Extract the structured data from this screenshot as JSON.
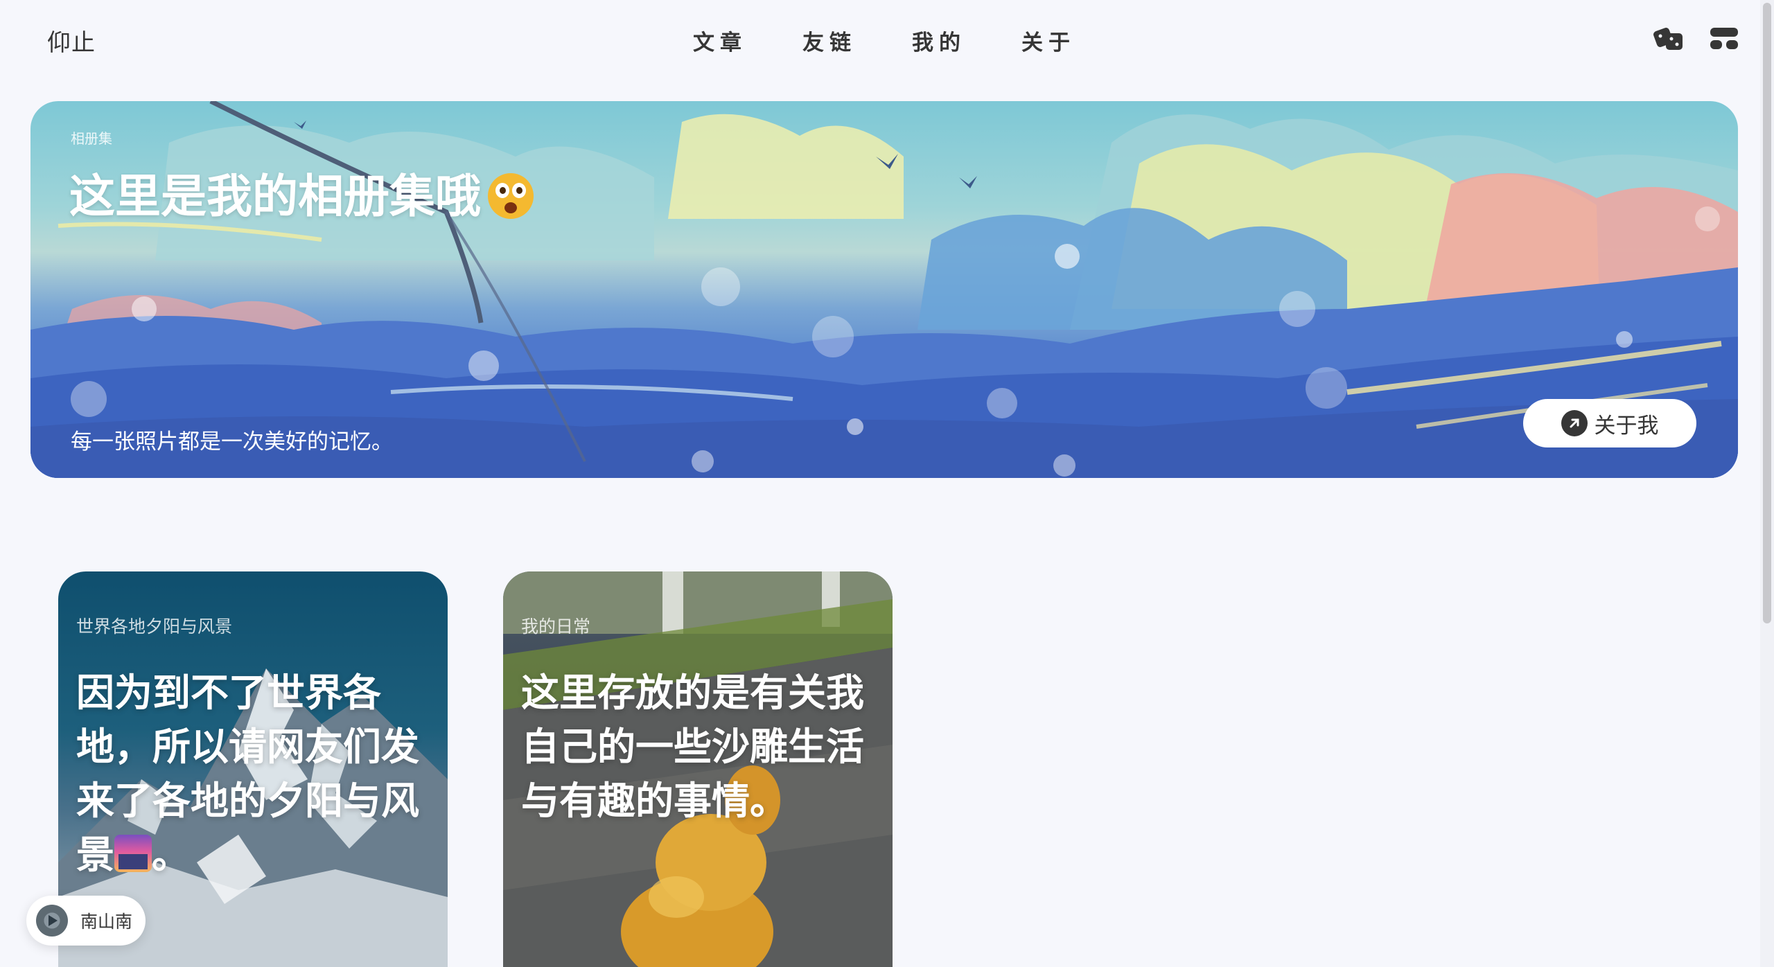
{
  "site": {
    "title": "仰止"
  },
  "nav": {
    "menu": [
      {
        "label": "文章"
      },
      {
        "label": "友链"
      },
      {
        "label": "我的"
      },
      {
        "label": "关于"
      }
    ],
    "icons": [
      "dice-icon",
      "menu-grid-icon"
    ]
  },
  "banner": {
    "kicker": "相册集",
    "title": "这里是我的相册集哦",
    "description": "每一张照片都是一次美好的记忆。",
    "button_label": "关于我",
    "colors": {
      "sky": "#7ec8d6",
      "mountain": "#3f66c0",
      "cloud": "#f2eba0"
    }
  },
  "albums": [
    {
      "kicker": "世界各地夕阳与风景",
      "text": "因为到不了世界各地，所以请网友们发来了各地的夕阳与风景",
      "suffix": "。"
    },
    {
      "kicker": "我的日常",
      "text": "这里存放的是有关我自己的一些沙雕生活与有趣的事情。"
    }
  ],
  "player": {
    "song": "南山南"
  },
  "colors": {
    "background": "#f6f7fc",
    "text": "#363636",
    "accent_white": "#ffffff"
  }
}
